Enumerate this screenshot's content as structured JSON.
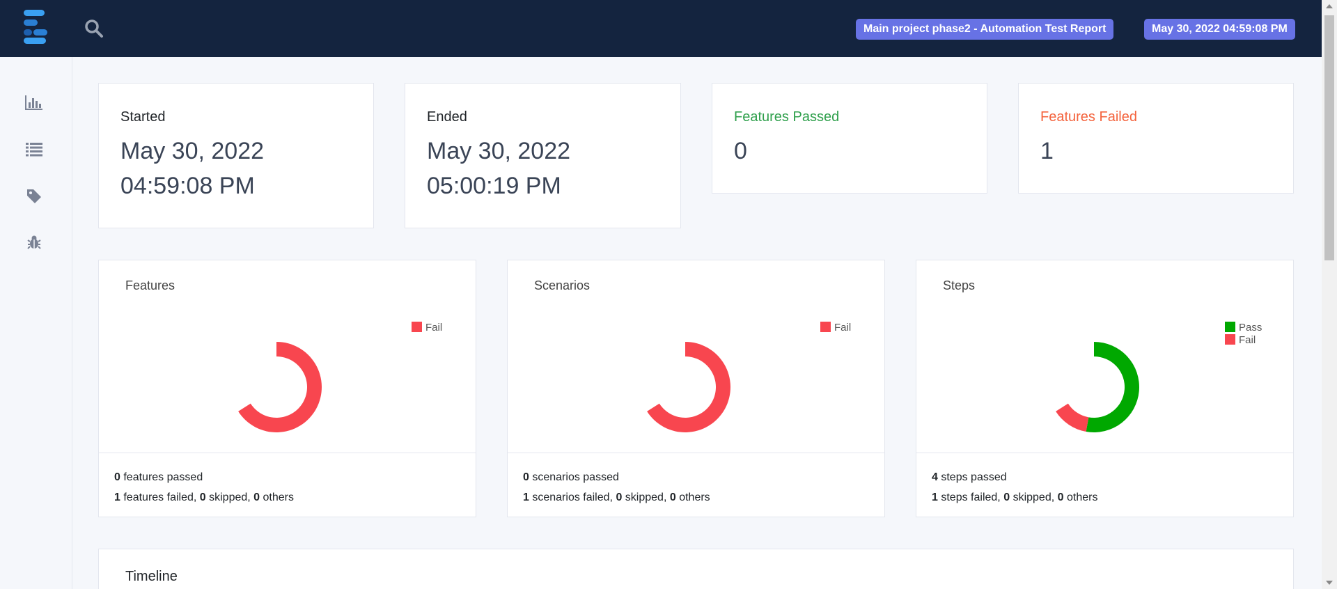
{
  "header": {
    "report_title": "Main project phase2 - Automation Test Report",
    "report_date": "May 30, 2022 04:59:08 PM"
  },
  "sidebar": {
    "items": [
      {
        "icon": "bar-chart-icon",
        "label": "Dashboard"
      },
      {
        "icon": "list-icon",
        "label": "Features"
      },
      {
        "icon": "tag-icon",
        "label": "Tags"
      },
      {
        "icon": "bug-icon",
        "label": "Exceptions"
      }
    ]
  },
  "stats": {
    "started": {
      "label": "Started",
      "value": "May 30, 2022 04:59:08 PM"
    },
    "ended": {
      "label": "Ended",
      "value": "May 30, 2022 05:00:19 PM"
    },
    "features_passed": {
      "label": "Features Passed",
      "value": "0"
    },
    "features_failed": {
      "label": "Features Failed",
      "value": "1"
    }
  },
  "colors": {
    "pass": "#00a800",
    "fail": "#f8464f",
    "pass_label": "#2e9f4b",
    "fail_label": "#f4633d",
    "accent": "#6772e5",
    "topbar": "#14243f"
  },
  "chart_data": [
    {
      "type": "pie",
      "title": "Features",
      "legend_position": "top-right",
      "slices": [
        {
          "label": "Fail",
          "value": 1
        }
      ],
      "footer": {
        "passed": "0",
        "passed_text": "features passed",
        "failed": "1",
        "failed_text": "features failed,",
        "skipped": "0",
        "skipped_text": "skipped,",
        "others": "0",
        "others_text": "others"
      }
    },
    {
      "type": "pie",
      "title": "Scenarios",
      "legend_position": "top-right",
      "slices": [
        {
          "label": "Fail",
          "value": 1
        }
      ],
      "footer": {
        "passed": "0",
        "passed_text": "scenarios passed",
        "failed": "1",
        "failed_text": "scenarios failed,",
        "skipped": "0",
        "skipped_text": "skipped,",
        "others": "0",
        "others_text": "others"
      }
    },
    {
      "type": "pie",
      "title": "Steps",
      "legend_position": "top-right",
      "slices": [
        {
          "label": "Pass",
          "value": 4
        },
        {
          "label": "Fail",
          "value": 1
        }
      ],
      "footer": {
        "passed": "4",
        "passed_text": "steps passed",
        "failed": "1",
        "failed_text": "steps failed,",
        "skipped": "0",
        "skipped_text": "skipped,",
        "others": "0",
        "others_text": "others"
      }
    }
  ],
  "timeline": {
    "title": "Timeline"
  }
}
